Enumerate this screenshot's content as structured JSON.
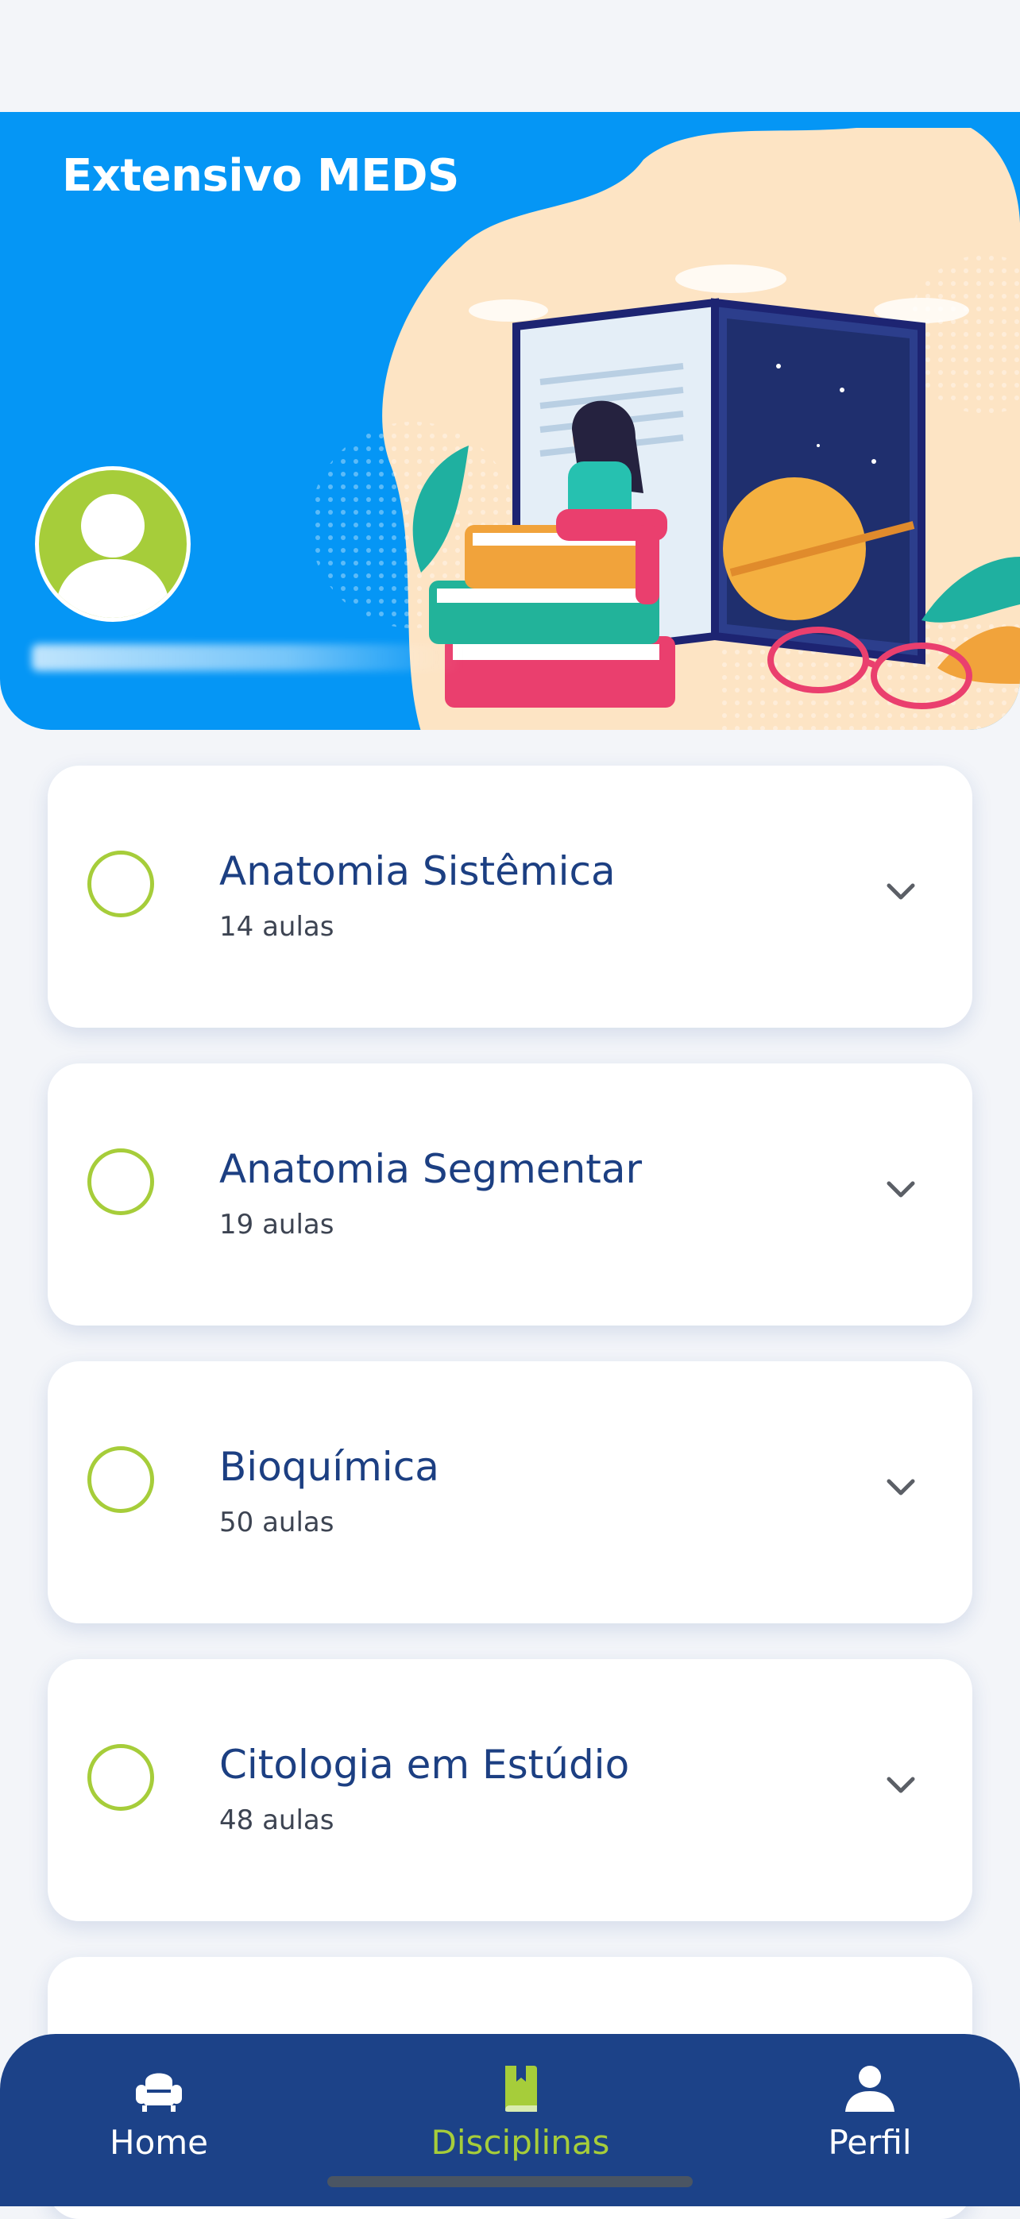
{
  "header": {
    "title": "Extensivo MEDS"
  },
  "courses": [
    {
      "title": "Anatomia Sistêmica",
      "count": "14 aulas"
    },
    {
      "title": "Anatomia Segmentar",
      "count": "19 aulas"
    },
    {
      "title": "Bioquímica",
      "count": "50 aulas"
    },
    {
      "title": "Citologia em Estúdio",
      "count": "48 aulas"
    },
    {
      "title": "",
      "count": ""
    }
  ],
  "bottom_nav": {
    "items": [
      {
        "label": "Home",
        "icon": "armchair-icon"
      },
      {
        "label": "Disciplinas",
        "icon": "book-icon",
        "active": true
      },
      {
        "label": "Perfil",
        "icon": "person-icon"
      }
    ]
  },
  "colors": {
    "hero": "#0596f5",
    "accent_green": "#a6cd3a",
    "title_navy": "#1c3f82",
    "nav_bg": "#1c4288"
  }
}
